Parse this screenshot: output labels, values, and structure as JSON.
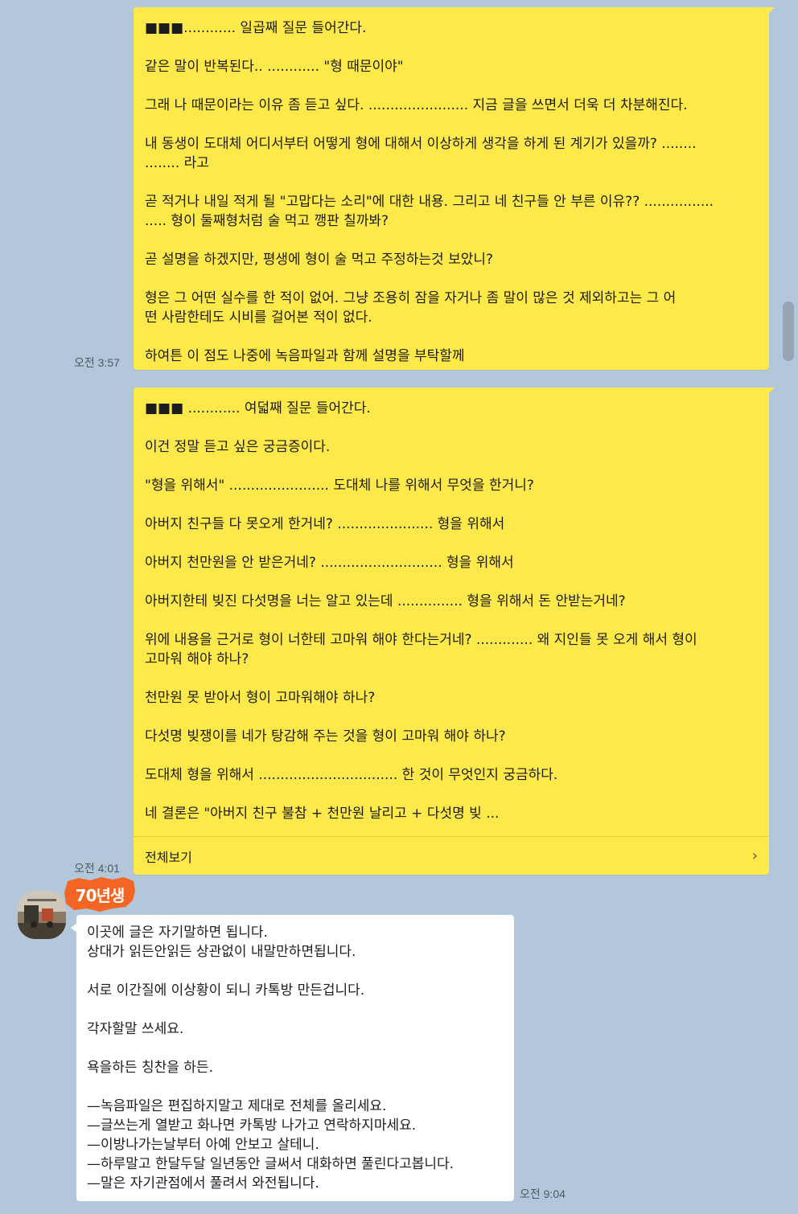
{
  "messages": [
    {
      "time": "오전 3:57",
      "text": "■■■............ 일곱째 질문 들어간다.\n\n같은 말이 반복된다.. ............ \"형 때문이야\"\n\n그래 나 때문이라는 이유 좀 듣고 싶다. ....................... 지금 글을 쓰면서 더욱 더 차분해진다.\n\n내 동생이 도대체 어디서부터 어떻게 형에 대해서 이상하게 생각을 하게 된 계기가 있을까? ........\n........ 라고\n\n곧 적거나 내일 적게 될 \"고맙다는 소리\"에 대한 내용. 그리고 네 친구들 안 부른 이유?? ................\n..... 형이 둘째형처럼 술 먹고 깽판 칠까봐?\n\n곧 설명을 하겠지만, 평생에 형이 술 먹고 주정하는것 보았니?\n\n형은 그 어떤 실수를 한 적이 없어. 그냥 조용히 잠을 자거나 좀 말이 많은 것 제외하고는 그 어\n떤 사람한테도 시비를 걸어본 적이 없다.\n\n하여튼 이 점도 나중에 녹음파일과 함께 설명을 부탁할께"
    },
    {
      "time": "오전 4:01",
      "text": "■■■ ............ 여덟째 질문 들어간다.\n\n이건 정말 듣고 싶은 궁금증이다.\n\n\"형을 위해서\" ....................... 도대체 나를 위해서 무엇을 한거니?\n\n아버지 친구들 다 못오게 한거네? ...................... 형을 위해서\n\n아버지 천만원을 안 받은거네? ............................ 형을 위해서\n\n아버지한테 빚진 다섯명을 너는 알고 있는데 ............... 형을 위해서 돈 안받는거네?\n\n위에 내용을 근거로 형이 너한테 고마워 해야 한다는거네? ............. 왜 지인들 못 오게 해서 형이\n고마워 해야 하나?\n\n천만원 못 받아서 형이 고마워해야 하나?\n\n다섯명 빚쟁이를 네가 탕감해 주는 것을 형이 고마워 해야 하나?\n\n도대체 형을 위해서 ................................ 한 것이 무엇인지 궁금하다.\n\n네 결론은 \"아버지 친구 불참 + 천만원 날리고 + 다섯명 빚 ...",
      "more_label": "전체보기"
    },
    {
      "time": "오전 9:04",
      "badge": "70년생",
      "text": "이곳에 글은 자기말하면 됩니다.\n상대가 읽든안읽든 상관없이 내말만하면됩니다.\n\n서로 이간질에 이상황이 되니 카톡방 만든겁니다.\n\n각자할말 쓰세요.\n\n욕을하든 칭찬을 하든.\n\n—녹음파일은 편집하지말고 제대로 전체를 올리세요.\n—글쓰는게 열받고 화나면 카톡방 나가고 연락하지마세요.\n—이방나가는날부터 아예 안보고 살테니.\n—하루말고 한달두달 일년동안 글써서 대화하면 풀린다고봅니다.\n—말은 자기관점에서 풀려서 와전됩니다."
    }
  ],
  "colors": {
    "background": "#b2c7d9",
    "my_bubble": "#fee94a",
    "other_bubble": "#ffffff",
    "badge": "#f26522"
  }
}
